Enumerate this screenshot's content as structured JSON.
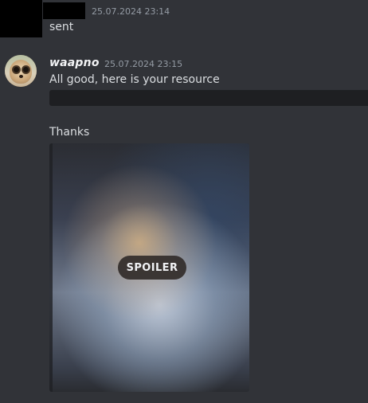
{
  "message1": {
    "timestamp": "25.07.2024 23:14",
    "text": "sent"
  },
  "message2": {
    "username": "waapno",
    "timestamp": "25.07.2024 23:15",
    "line1": "All good, here is your resource",
    "line2": "Thanks",
    "attachment": {
      "spoiler_label": "SPOILER"
    }
  },
  "colors": {
    "background": "#313338",
    "text": "#dbdee1",
    "timestamp": "#949ba4",
    "username": "#f2f3f5",
    "spoiler_bar": "#1e1f22"
  }
}
